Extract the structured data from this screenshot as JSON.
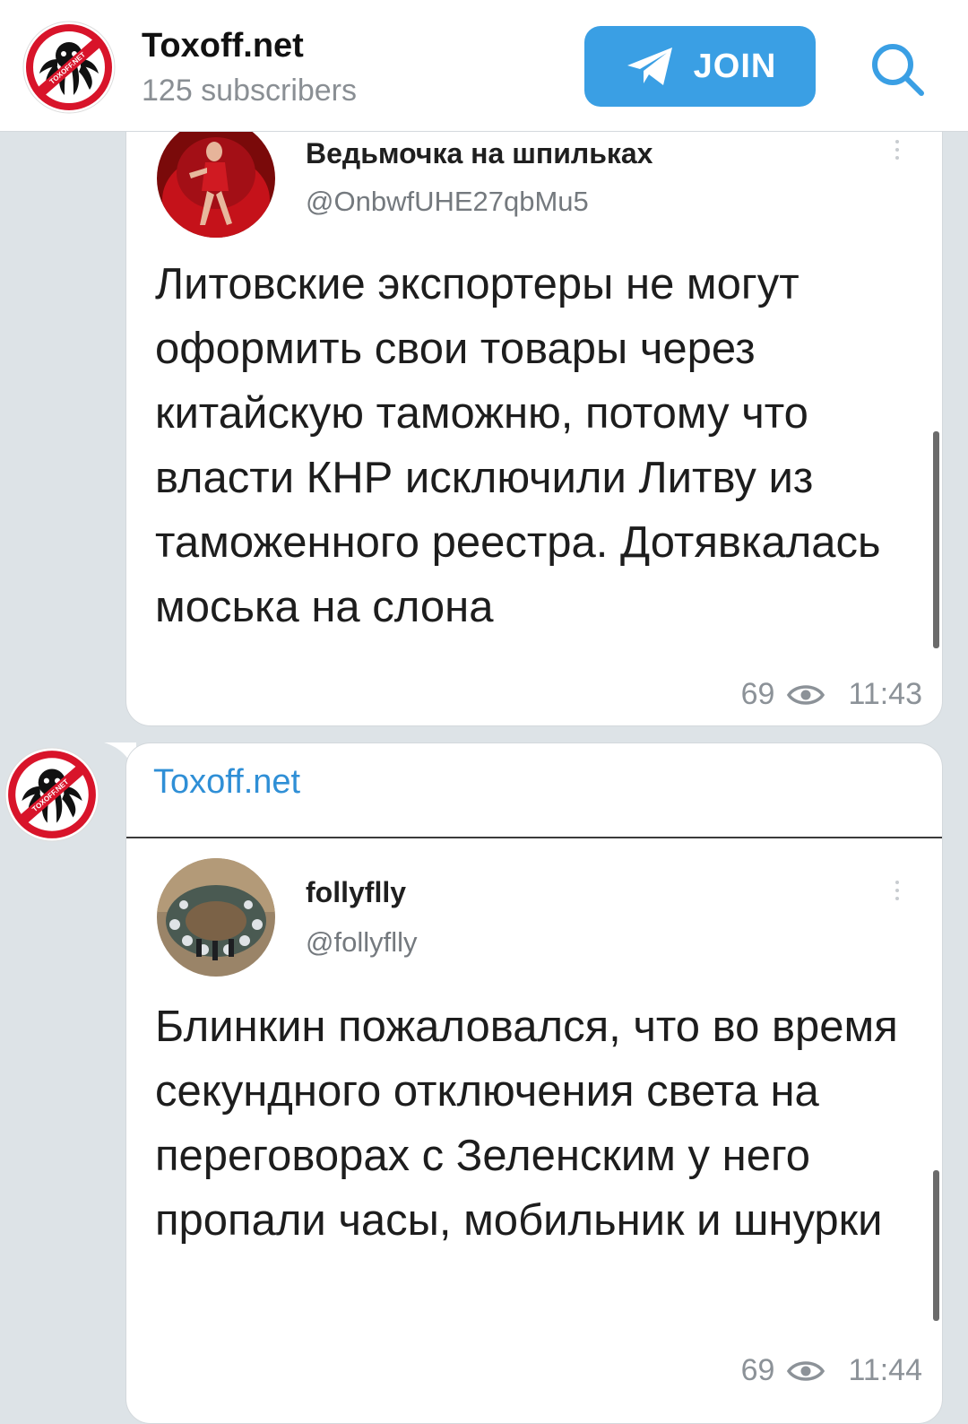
{
  "header": {
    "title": "Toxoff.net",
    "subscribers": "125 subscribers",
    "join_label": "JOIN",
    "avatar_text": "TOXOFF.NET"
  },
  "messages": [
    {
      "sender": "",
      "tweet": {
        "name": "Ведьмочка на шпильках",
        "handle": "@OnbwfUHE27qbMu5",
        "text": "Литовские экспортеры не могут оформить свои товары через китайскую таможню, потому что власти КНР исключили Литву из таможенного реестра. Дотявкалась моська на слона"
      },
      "views": "69",
      "time": "11:43"
    },
    {
      "sender": "Toxoff.net",
      "tweet": {
        "name": "follyflly",
        "handle": "@follyflly",
        "text": "Блинкин пожаловался, что во время секундного отключения света на переговорах с Зеленским у него пропали часы, мобильник и шнурки"
      },
      "views": "69",
      "time": "11:44"
    }
  ],
  "colors": {
    "accent": "#3a9fe4",
    "sender_name": "#2f8fd6",
    "background": "#dde3e7",
    "logo_red": "#d8142a"
  },
  "icons": [
    "telegram-plane-icon",
    "search-icon",
    "eye-icon",
    "more-vertical-icon"
  ]
}
